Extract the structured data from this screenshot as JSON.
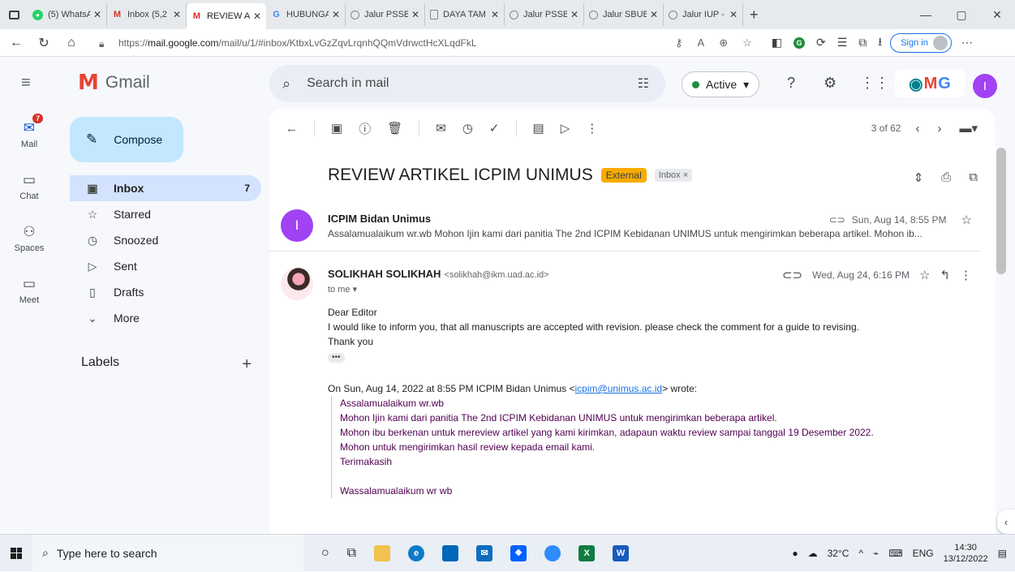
{
  "browser": {
    "tabs": [
      {
        "title": "(5) WhatsA",
        "fav": "wa",
        "active": false
      },
      {
        "title": "Inbox (5,2",
        "fav": "gm",
        "active": false
      },
      {
        "title": "REVIEW AF",
        "fav": "gm",
        "active": true
      },
      {
        "title": "HUBUNGA",
        "fav": "g",
        "active": false
      },
      {
        "title": "Jalur PSSB",
        "fav": "circ",
        "active": false
      },
      {
        "title": "DAYA TAM",
        "fav": "doc",
        "active": false
      },
      {
        "title": "Jalur PSSB",
        "fav": "circ",
        "active": false
      },
      {
        "title": "Jalur SBUB",
        "fav": "circ",
        "active": false
      },
      {
        "title": "Jalur IUP -",
        "fav": "circ",
        "active": false
      }
    ],
    "url_prefix": "https://",
    "url_host": "mail.google.com",
    "url_path": "/mail/u/1/#inbox/KtbxLvGzZqvLrqnhQQmVdrwctHcXLqdFkL",
    "signin_label": "Sign in"
  },
  "gmail": {
    "logo_word": "Gmail",
    "search_placeholder": "Search in mail",
    "status_label": "Active",
    "rail": [
      {
        "label": "Mail",
        "badge": "7"
      },
      {
        "label": "Chat"
      },
      {
        "label": "Spaces"
      },
      {
        "label": "Meet"
      }
    ],
    "compose_label": "Compose",
    "nav": [
      {
        "label": "Inbox",
        "count": "7",
        "icon": "inbox-icon"
      },
      {
        "label": "Starred",
        "count": "",
        "icon": "star-icon"
      },
      {
        "label": "Snoozed",
        "count": "",
        "icon": "clock-icon"
      },
      {
        "label": "Sent",
        "count": "",
        "icon": "send-icon"
      },
      {
        "label": "Drafts",
        "count": "",
        "icon": "draft-icon"
      },
      {
        "label": "More",
        "count": "",
        "icon": "chevron-down-icon"
      }
    ],
    "labels_heading": "Labels",
    "pager": "3 of 62",
    "thread": {
      "subject": "REVIEW ARTIKEL ICPIM UNIMUS",
      "tag_external": "External",
      "tag_inbox": "Inbox ×",
      "msg1": {
        "avatar_letter": "I",
        "from": "ICPIM Bidan Unimus",
        "date": "Sun, Aug 14, 8:55 PM",
        "snippet": "Assalamualaikum wr.wb Mohon Ijin kami dari panitia The 2nd ICPIM Kebidanan UNIMUS untuk mengirimkan beberapa artikel. Mohon ib..."
      },
      "msg2": {
        "from": "SOLIKHAH SOLIKHAH",
        "email": "<solikhah@ikm.uad.ac.id>",
        "to": "to me ▾",
        "date": "Wed, Aug 24, 6:16 PM",
        "body": [
          "Dear Editor",
          "I would like to inform you, that all manuscripts are accepted with revision. please check the comment for a guide to revising.",
          "Thank you"
        ],
        "quote_prefix": "On Sun, Aug 14, 2022 at 8:55 PM ICPIM Bidan Unimus <",
        "quote_link": "icpim@unimus.ac.id",
        "quote_suffix": "> wrote:",
        "quote_lines": [
          "Assalamualaikum wr.wb",
          "Mohon Ijin kami dari panitia The 2nd ICPIM Kebidanan UNIMUS untuk mengirimkan beberapa artikel.",
          "Mohon ibu berkenan untuk mereview artikel yang kami kirimkan, adapaun waktu review sampai tanggal 19 Desember 2022.",
          "Mohon untuk mengirimkan hasil review kepada email kami.",
          "Terimakasih",
          "",
          "Wassalamualaikum wr wb"
        ]
      }
    },
    "account_letter": "I"
  },
  "taskbar": {
    "search_placeholder": "Type here to search",
    "temperature": "32°C",
    "lang": "ENG",
    "time": "14:30",
    "date": "13/12/2022"
  }
}
